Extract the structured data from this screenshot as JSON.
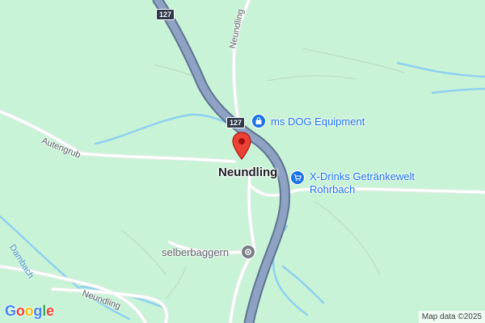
{
  "map": {
    "highway_shield": "127",
    "highway_shield_2": "127",
    "road_labels": {
      "neundling_north": "Neundling",
      "autengrub": "Autengrub",
      "neundling_south": "Neundling"
    },
    "water_labels": {
      "dambach": "Dambach"
    },
    "town_label": "Neundling",
    "pois": [
      {
        "name": "ms DOG Equipment",
        "icon": "shopping-bag-icon",
        "color": "#1a73e8"
      },
      {
        "name": "X-Drinks Getränkewelt\nRohrbach",
        "icon": "shopping-cart-icon",
        "color": "#1a73e8"
      },
      {
        "name": "selberbaggern",
        "icon": "place-dot-icon",
        "color": "#7a7f86"
      }
    ],
    "marker_color": "#ea4335",
    "logo": {
      "letters": [
        {
          "ch": "G",
          "color": "#4285f4"
        },
        {
          "ch": "o",
          "color": "#ea4335"
        },
        {
          "ch": "o",
          "color": "#fbbc05"
        },
        {
          "ch": "g",
          "color": "#4285f4"
        },
        {
          "ch": "l",
          "color": "#34a853"
        },
        {
          "ch": "e",
          "color": "#ea4335"
        }
      ]
    },
    "attribution": "Map data ©2025"
  }
}
